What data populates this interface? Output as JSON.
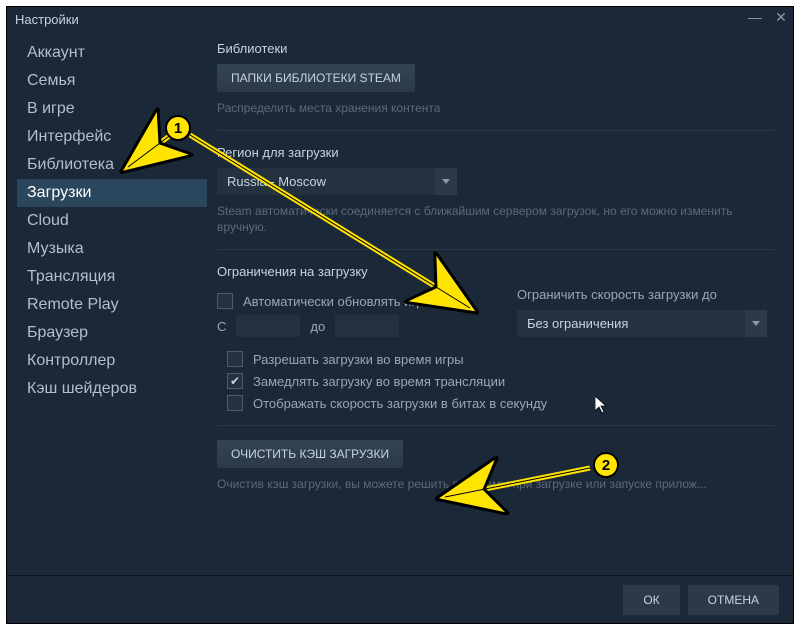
{
  "window": {
    "title": "Настройки"
  },
  "sidebar": {
    "items": [
      {
        "label": "Аккаунт"
      },
      {
        "label": "Семья"
      },
      {
        "label": "В игре"
      },
      {
        "label": "Интерфейс"
      },
      {
        "label": "Библиотека"
      },
      {
        "label": "Загрузки",
        "active": true
      },
      {
        "label": "Cloud"
      },
      {
        "label": "Музыка"
      },
      {
        "label": "Трансляция"
      },
      {
        "label": "Remote Play"
      },
      {
        "label": "Браузер"
      },
      {
        "label": "Контроллер"
      },
      {
        "label": "Кэш шейдеров"
      }
    ]
  },
  "content": {
    "libraries": {
      "title": "Библиотеки",
      "button": "ПАПКИ БИБЛИОТЕКИ STEAM",
      "hint": "Распределить места хранения контента"
    },
    "region": {
      "title": "Регион для загрузки",
      "value": "Russia - Moscow",
      "hint": "Steam автоматически соединяется с ближайшим сервером загрузок, но его можно изменить вручную."
    },
    "limits": {
      "title": "Ограничения на загрузку",
      "autoupdate_label": "Автоматически обновлять игры:",
      "from": "С",
      "to": "до",
      "limit_label": "Ограничить скорость загрузки до",
      "limit_value": "Без ограничения",
      "allow_ingame": "Разрешать загрузки во время игры",
      "throttle_stream": "Замедлять загрузку во время трансляции",
      "show_bits": "Отображать скорость загрузки в битах в секунду"
    },
    "clear": {
      "button": "ОЧИСТИТЬ КЭШ ЗАГРУЗКИ",
      "hint": "Очистив кэш загрузки, вы можете решить проблемы при загрузке или запуске прилож..."
    }
  },
  "footer": {
    "ok": "ОК",
    "cancel": "ОТМЕНА"
  },
  "annotations": {
    "b1": "1",
    "b2": "2"
  }
}
